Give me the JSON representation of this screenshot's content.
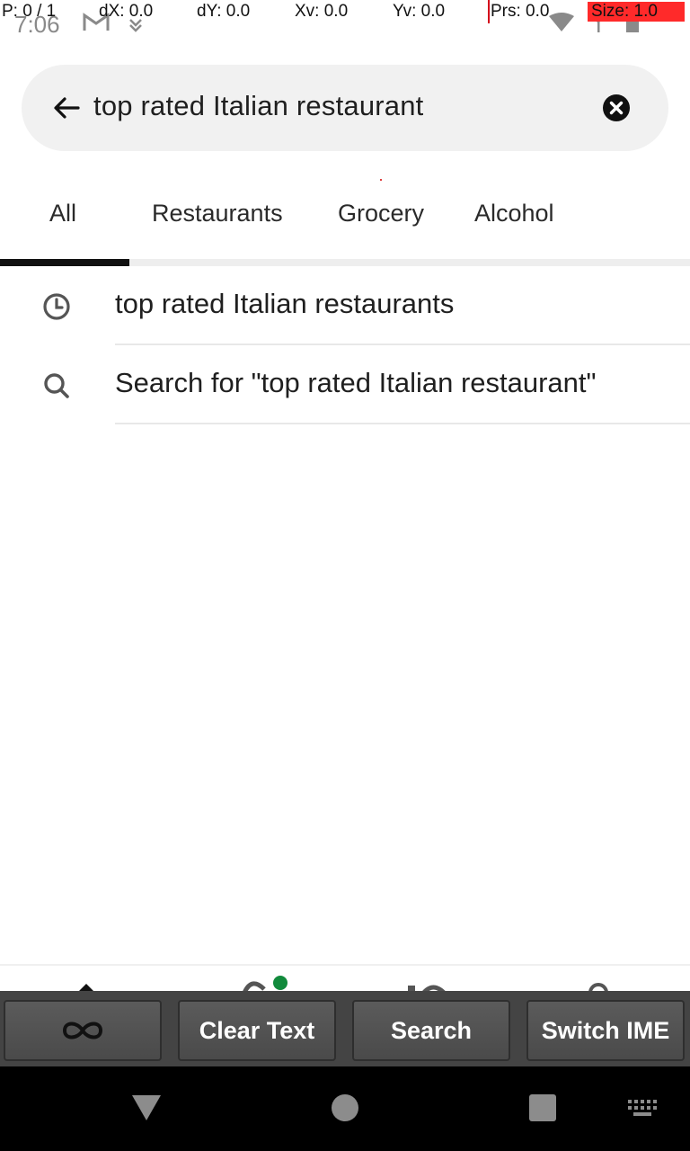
{
  "status_bar": {
    "time": "7:06",
    "icons": [
      "gmail-icon",
      "download-icon",
      "wifi-icon",
      "signal-icon",
      "battery-icon"
    ]
  },
  "debug_overlay": {
    "p": "P: 0 / 1",
    "dx": "dX: 0.0",
    "dy": "dY: 0.0",
    "xv": "Xv: 0.0",
    "yv": "Yv: 0.0",
    "prs": "Prs: 0.0",
    "size": "Size: 1.0",
    "highlight_color": "#ff2a2a"
  },
  "search": {
    "query": "top rated Italian restaurant",
    "back_icon": "arrow-left-icon",
    "clear_icon": "close-circle-icon"
  },
  "tabs": [
    {
      "label": "All",
      "selected": true
    },
    {
      "label": "Restaurants",
      "selected": false
    },
    {
      "label": "Grocery",
      "selected": false
    },
    {
      "label": "Alcohol",
      "selected": false
    }
  ],
  "suggestions": [
    {
      "icon": "clock-icon",
      "text": "top rated Italian restaurants"
    },
    {
      "icon": "search-icon",
      "text": "Search for \"top rated Italian restaurant\""
    }
  ],
  "bottom_nav": {
    "icons": [
      "home-icon",
      "grocery-icon",
      "orders-icon",
      "account-icon"
    ],
    "badge_color": "#118a3c"
  },
  "ime_bar": {
    "buttons": [
      {
        "label": "",
        "icon": "infinity-icon"
      },
      {
        "label": "Clear Text"
      },
      {
        "label": "Search"
      },
      {
        "label": "Switch IME"
      }
    ]
  },
  "system_nav": {
    "icons": [
      "back-triangle-icon",
      "home-circle-icon",
      "recents-square-icon",
      "keyboard-icon"
    ]
  }
}
